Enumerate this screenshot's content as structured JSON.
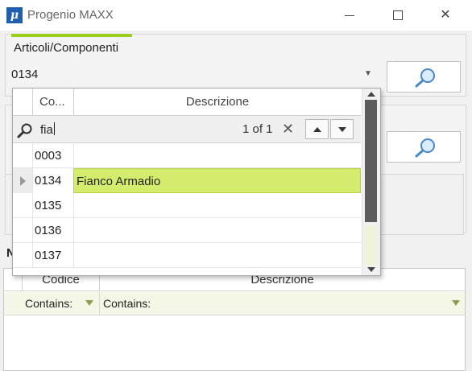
{
  "window": {
    "app_icon_glyph": "μ",
    "title": "Progenio MAXX",
    "minimize_icon": "minimize-icon",
    "maximize_icon": "maximize-icon",
    "close_glyph": "✕"
  },
  "section": {
    "tab_label": "Articoli/Componenti",
    "combo_value": "0134",
    "combo_arrow": "▼",
    "accent_color": "#9acd1e",
    "partial_label": "N"
  },
  "dropdown": {
    "columns": [
      "Co...",
      "Descrizione"
    ],
    "find": {
      "text": "fia",
      "count": "1 of 1",
      "clear_glyph": "✕"
    },
    "rows": [
      {
        "code": "0003",
        "desc": "",
        "selected": false
      },
      {
        "code": "0134",
        "desc": "Fianco Armadio",
        "selected": true
      },
      {
        "code": "0135",
        "desc": "",
        "selected": false
      },
      {
        "code": "0136",
        "desc": "",
        "selected": false
      },
      {
        "code": "0137",
        "desc": "",
        "selected": false
      }
    ],
    "highlight_color": "#d4ec6e"
  },
  "grid": {
    "columns": [
      "Codice",
      "Descrizione"
    ],
    "filters": [
      "Contains:",
      "Contains:"
    ]
  }
}
